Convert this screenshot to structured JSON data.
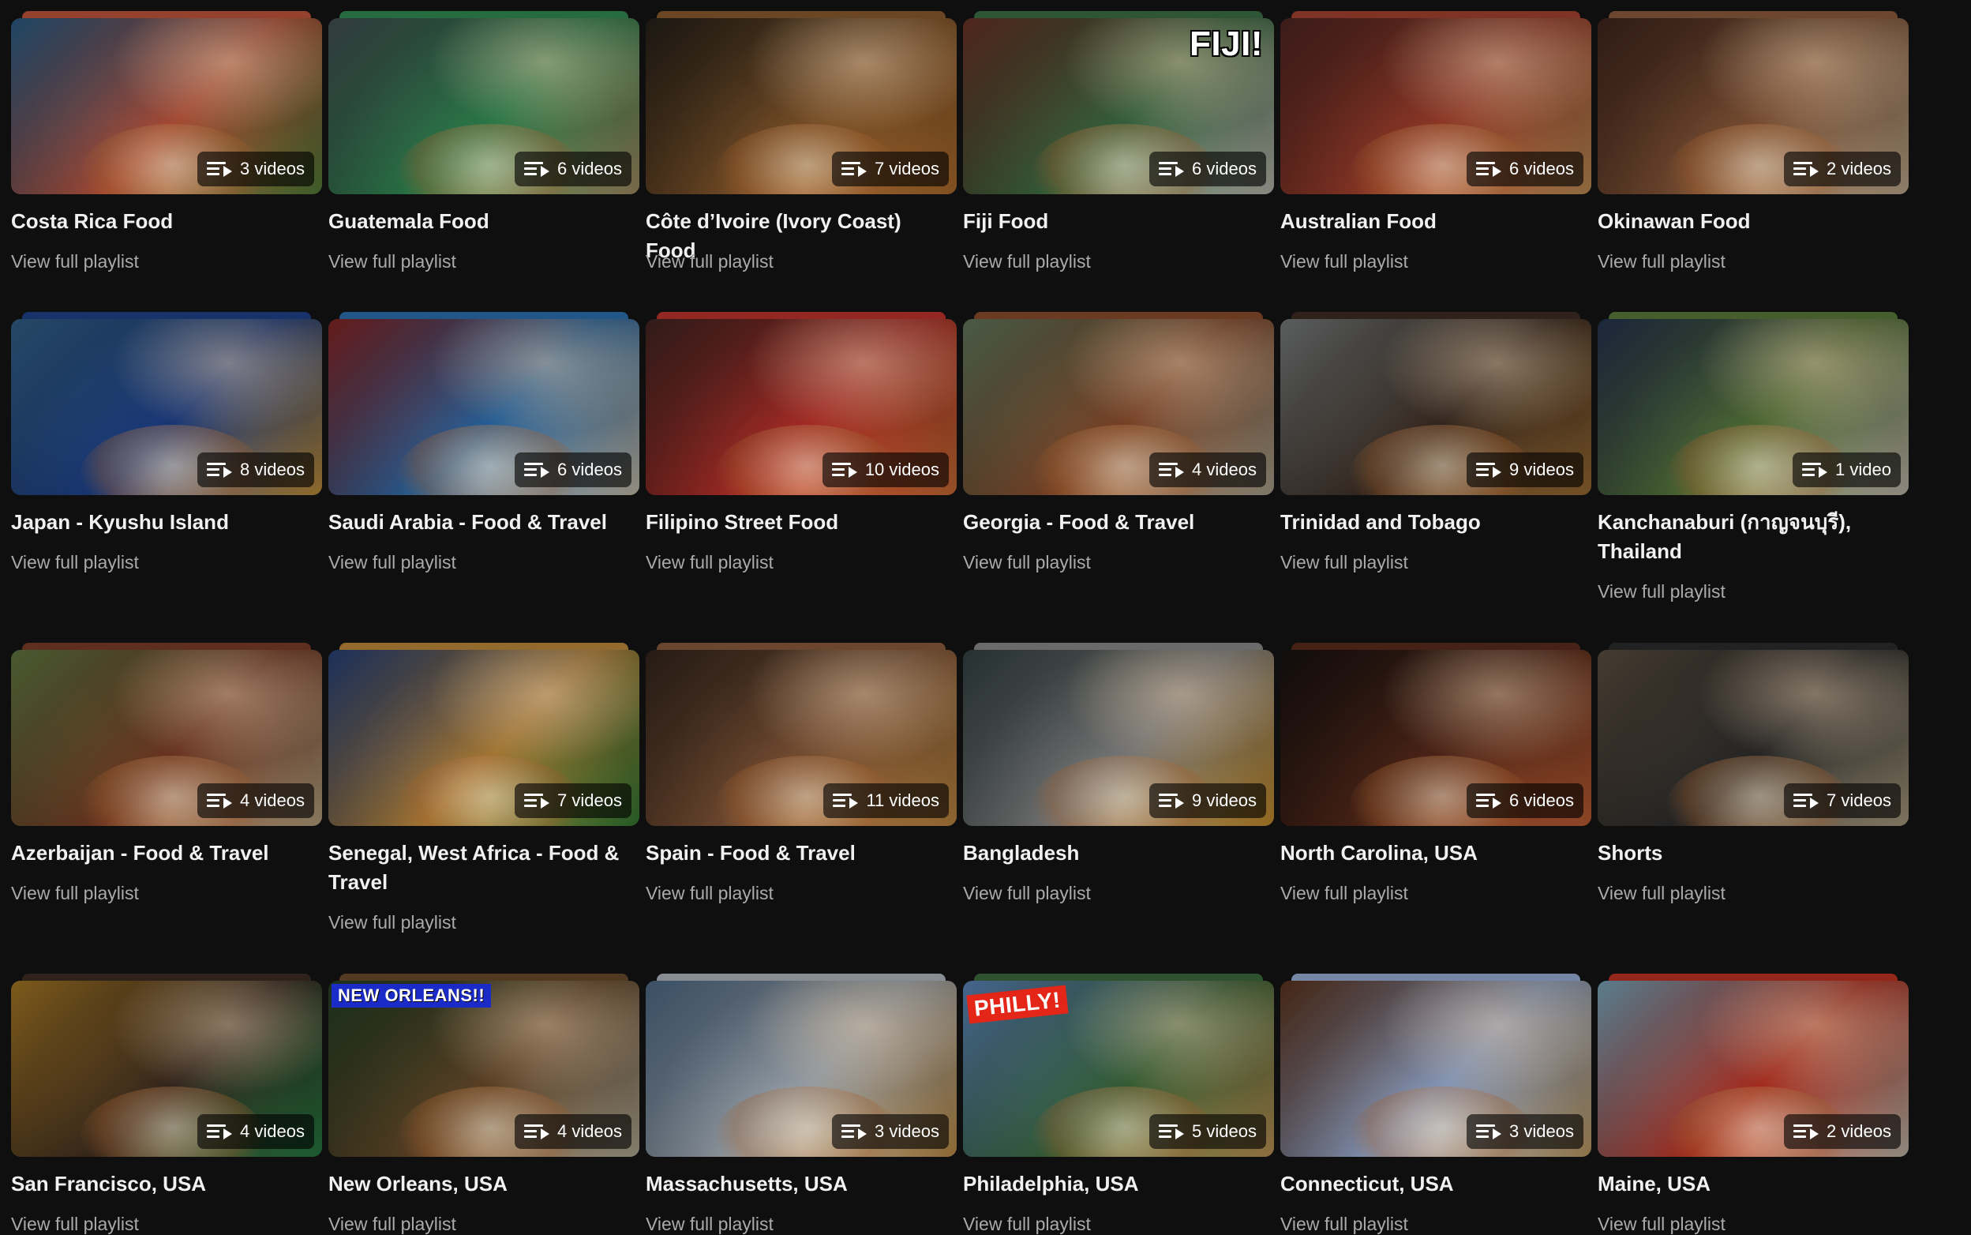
{
  "view_link_label": "View full playlist",
  "rows": [
    [
      {
        "title": "Costa Rica Food",
        "count": "3 videos",
        "colors": [
          "#2f6a9a",
          "#c2543a",
          "#5d8c3e"
        ]
      },
      {
        "title": "Guatemala Food",
        "count": "6 videos",
        "colors": [
          "#4c5b5e",
          "#2f8c52",
          "#b9a070"
        ]
      },
      {
        "title": "Côte d’Ivoire (Ivory Coast) Food",
        "count": "7 videos",
        "colors": [
          "#2a241c",
          "#8a5a2c",
          "#c57a32"
        ]
      },
      {
        "title": "Fiji Food",
        "count": "6 videos",
        "caption": "FIJI!",
        "caption_style": "fiji",
        "colors": [
          "#7a3a2c",
          "#3a6f44",
          "#d2cfc6"
        ]
      },
      {
        "title": "Australian Food",
        "count": "6 videos",
        "colors": [
          "#5b2a26",
          "#a6402c",
          "#d8a060"
        ]
      },
      {
        "title": "Okinawan Food",
        "count": "2 videos",
        "colors": [
          "#4a2a20",
          "#8c5a3a",
          "#d8c0a0"
        ]
      }
    ],
    [
      {
        "title": "Japan - Kyushu Island",
        "count": "8 videos",
        "colors": [
          "#3a6f9c",
          "#1c3f8a",
          "#d8a040"
        ]
      },
      {
        "title": "Saudi Arabia - Food & Travel",
        "count": "6 videos",
        "colors": [
          "#9a2a2a",
          "#2a6fb0",
          "#e0d6c0"
        ]
      },
      {
        "title": "Filipino Street Food",
        "count": "10 videos",
        "colors": [
          "#4a2a26",
          "#c0302a",
          "#e27a3a"
        ]
      },
      {
        "title": "Georgia - Food & Travel",
        "count": "4 videos",
        "colors": [
          "#6f8a6a",
          "#8a4a2a",
          "#c0b8a0"
        ]
      },
      {
        "title": "Trinidad and Tobago",
        "count": "9 videos",
        "colors": [
          "#8a9090",
          "#3a2a20",
          "#b07a3a"
        ]
      },
      {
        "title": "Kanchanaburi (กาญจนบุรี),\nThailand",
        "count": "1 video",
        "colors": [
          "#2a3a5a",
          "#5a7a3a",
          "#d8cfc0"
        ]
      }
    ],
    [
      {
        "title": "Azerbaijan - Food & Travel",
        "count": "4 videos",
        "colors": [
          "#6f8a4a",
          "#7a3a24",
          "#d0b890"
        ]
      },
      {
        "title": "Senegal, West Africa - Food &\nTravel",
        "count": "7 videos",
        "colors": [
          "#2a4a8a",
          "#c08a3a",
          "#3a8a3a"
        ]
      },
      {
        "title": "Spain - Food & Travel",
        "count": "11 videos",
        "colors": [
          "#3a2a20",
          "#8a5a3a",
          "#d89a4a"
        ]
      },
      {
        "title": "Bangladesh",
        "count": "9 videos",
        "colors": [
          "#3a4a4a",
          "#8a8a8a",
          "#e0a030"
        ]
      },
      {
        "title": "North Carolina, USA",
        "count": "6 videos",
        "colors": [
          "#1a1412",
          "#5a2a1a",
          "#d86a3a"
        ]
      },
      {
        "title": "Shorts",
        "count": "7 videos",
        "colors": [
          "#6a5a4a",
          "#2a2a2a",
          "#c0b090"
        ]
      }
    ],
    [
      {
        "title": "San Francisco, USA",
        "count": "4 videos",
        "colors": [
          "#c08a2a",
          "#3a2a20",
          "#2a8a4a"
        ]
      },
      {
        "title": "New Orleans, USA",
        "count": "4 videos",
        "caption": "NEW ORLEANS!!",
        "caption_style": "neworleans",
        "colors": [
          "#2a4a2a",
          "#6a4a2a",
          "#c8c0a8"
        ]
      },
      {
        "title": "Massachusetts, USA",
        "count": "3 videos",
        "colors": [
          "#5a7a9a",
          "#b0b8c0",
          "#d8a050"
        ]
      },
      {
        "title": "Philadelphia, USA",
        "count": "5 videos",
        "caption": "PHILLY!",
        "caption_style": "philly",
        "colors": [
          "#6a9ad8",
          "#3a6a3a",
          "#d8a860"
        ]
      },
      {
        "title": "Connecticut, USA",
        "count": "3 videos",
        "colors": [
          "#6a3a20",
          "#9ab0d8",
          "#d8b070"
        ]
      },
      {
        "title": "Maine, USA",
        "count": "2 videos",
        "colors": [
          "#8ac0d8",
          "#c03020",
          "#d8d0c0"
        ]
      }
    ]
  ]
}
